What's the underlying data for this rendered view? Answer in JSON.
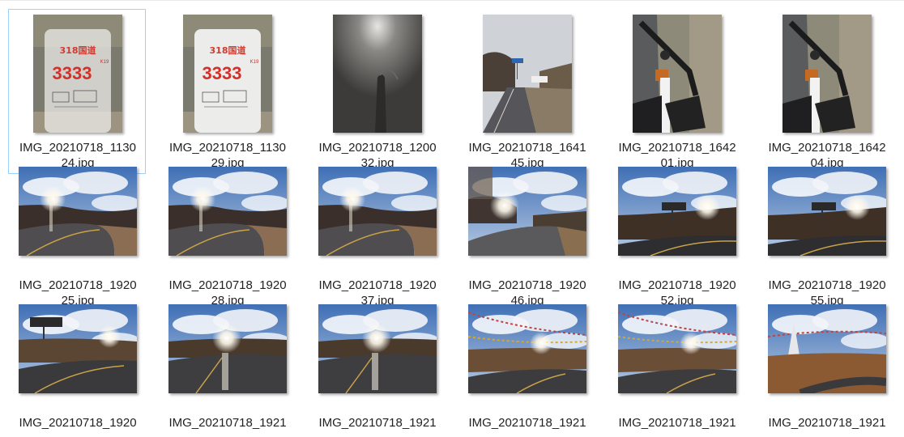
{
  "files": [
    {
      "line1": "IMG_20210718_1130",
      "line2": "24.jpg",
      "thumb": "milestone-blur",
      "orientation": "portrait",
      "selected": true
    },
    {
      "line1": "IMG_20210718_1130",
      "line2": "29.jpg",
      "thumb": "milestone",
      "orientation": "portrait",
      "selected": false
    },
    {
      "line1": "IMG_20210718_1200",
      "line2": "32.jpg",
      "thumb": "dark-flash",
      "orientation": "portrait",
      "selected": false
    },
    {
      "line1": "IMG_20210718_1641",
      "line2": "45.jpg",
      "thumb": "road-sign",
      "orientation": "portrait",
      "selected": false
    },
    {
      "line1": "IMG_20210718_1642",
      "line2": "01.jpg",
      "thumb": "bike",
      "orientation": "portrait",
      "selected": false
    },
    {
      "line1": "IMG_20210718_1642",
      "line2": "04.jpg",
      "thumb": "bike",
      "orientation": "portrait",
      "selected": false
    },
    {
      "line1": "IMG_20210718_1920",
      "line2": "25.jpg",
      "thumb": "road-curve",
      "orientation": "landscape",
      "selected": false
    },
    {
      "line1": "IMG_20210718_1920",
      "line2": "28.jpg",
      "thumb": "road-curve",
      "orientation": "landscape",
      "selected": false
    },
    {
      "line1": "IMG_20210718_1920",
      "line2": "37.jpg",
      "thumb": "road-curve",
      "orientation": "landscape",
      "selected": false
    },
    {
      "line1": "IMG_20210718_1920",
      "line2": "46.jpg",
      "thumb": "road-wide",
      "orientation": "landscape",
      "selected": false
    },
    {
      "line1": "IMG_20210718_1920",
      "line2": "52.jpg",
      "thumb": "sign-sky",
      "orientation": "landscape",
      "selected": false
    },
    {
      "line1": "IMG_20210718_1920",
      "line2": "55.jpg",
      "thumb": "sign-sky",
      "orientation": "landscape",
      "selected": false
    },
    {
      "line1": "IMG_20210718_1920",
      "line2": "",
      "thumb": "sign-road",
      "orientation": "landscape",
      "selected": false
    },
    {
      "line1": "IMG_20210718_1921",
      "line2": "",
      "thumb": "road-sun",
      "orientation": "landscape",
      "selected": false
    },
    {
      "line1": "IMG_20210718_1921",
      "line2": "",
      "thumb": "road-sun",
      "orientation": "landscape",
      "selected": false
    },
    {
      "line1": "IMG_20210718_1921",
      "line2": "",
      "thumb": "flags-road",
      "orientation": "landscape",
      "selected": false
    },
    {
      "line1": "IMG_20210718_1921",
      "line2": "",
      "thumb": "flags-road",
      "orientation": "landscape",
      "selected": false
    },
    {
      "line1": "IMG_20210718_1921",
      "line2": "",
      "thumb": "stupa",
      "orientation": "landscape",
      "selected": false
    }
  ],
  "milestone": {
    "route": "318国道",
    "km": "3333",
    "small": "K19"
  }
}
